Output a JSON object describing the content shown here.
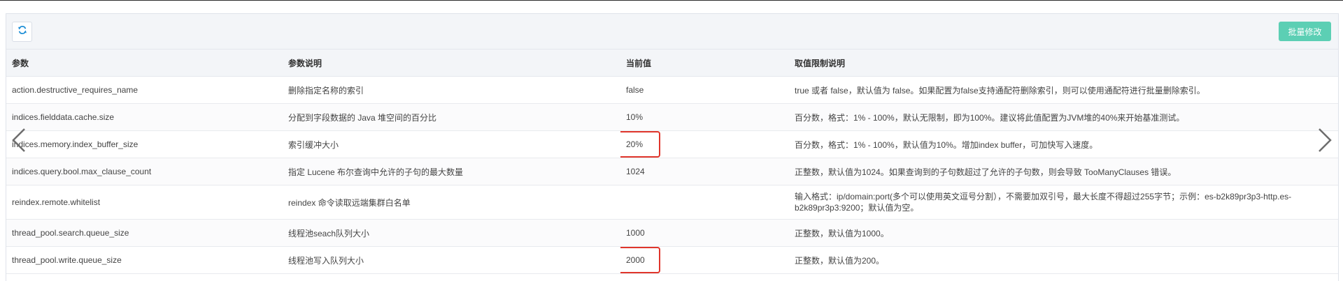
{
  "toolbar": {
    "refresh_icon": "refresh-icon",
    "batch_label": "批量修改"
  },
  "columns": [
    "参数",
    "参数说明",
    "当前值",
    "取值限制说明"
  ],
  "rows": [
    {
      "param": "action.destructive_requires_name",
      "desc": "删除指定名称的索引",
      "value": "false",
      "limit": "true 或者 false，默认值为 false。如果配置为false支持通配符删除索引，则可以使用通配符进行批量删除索引。"
    },
    {
      "param": "indices.fielddata.cache.size",
      "desc": "分配到字段数据的 Java 堆空间的百分比",
      "value": "10%",
      "limit": "百分数，格式：1% - 100%，默认无限制，即为100%。建议将此值配置为JVM堆的40%来开始基准测试。"
    },
    {
      "param": "indices.memory.index_buffer_size",
      "desc": "索引缓冲大小",
      "value": "20%",
      "limit": "百分数，格式：1% - 100%，默认值为10%。增加index buffer，可加快写入速度。"
    },
    {
      "param": "indices.query.bool.max_clause_count",
      "desc": "指定 Lucene 布尔查询中允许的子句的最大数量",
      "value": "1024",
      "limit": "正整数，默认值为1024。如果查询到的子句数超过了允许的子句数，则会导致 TooManyClauses 错误。"
    },
    {
      "param": "reindex.remote.whitelist",
      "desc": "reindex 命令读取远端集群白名单",
      "value": "",
      "limit": "输入格式：ip/domain:port(多个可以使用英文逗号分割），不需要加双引号，最大长度不得超过255字节；示例：es-b2k89pr3p3-http.es-b2k89pr3p3:9200；默认值为空。"
    },
    {
      "param": "thread_pool.search.queue_size",
      "desc": "线程池seach队列大小",
      "value": "1000",
      "limit": "正整数，默认值为1000。"
    },
    {
      "param": "thread_pool.write.queue_size",
      "desc": "线程池写入队列大小",
      "value": "2000",
      "limit": "正整数，默认值为200。"
    }
  ],
  "nav": {
    "prev_icon": "chevron-left-icon",
    "next_icon": "chevron-right-icon"
  }
}
